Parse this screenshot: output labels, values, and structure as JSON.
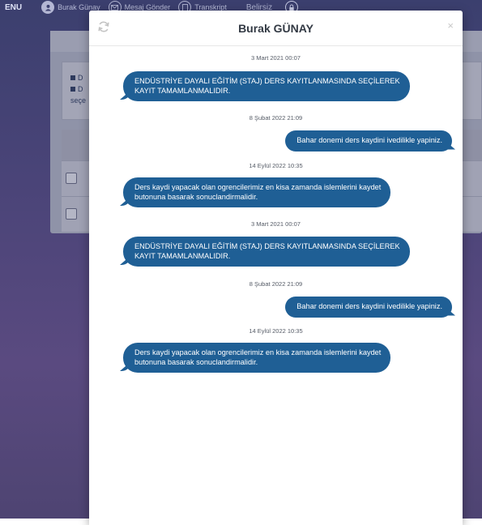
{
  "topbar": {
    "menu_label": "ENU",
    "items": [
      {
        "label": "Burak Günay",
        "icon": "user-icon"
      },
      {
        "label": "Mesaj Gönder",
        "icon": "envelope-icon"
      },
      {
        "label": "Transkript",
        "icon": "document-icon"
      }
    ],
    "status_label": "Belirsiz",
    "lock_icon": "lock-icon"
  },
  "background": {
    "card_lines": [
      "D",
      "D",
      "seçe"
    ]
  },
  "modal": {
    "title": "Burak GÜNAY",
    "refresh_icon": "refresh-icon",
    "close_glyph": "×"
  },
  "messages": [
    {
      "time": "3 Mart 2021 00:07",
      "side": "left",
      "lines": [
        "ENDÜSTRİYE DAYALI EĞİTİM (STAJ) DERS KAYITLANMASINDA SEÇİLEREK",
        "KAYIT TAMAMLANMALIDIR."
      ]
    },
    {
      "time": "8 Şubat 2022 21:09",
      "side": "right",
      "lines": [
        "Bahar donemi ders kaydini ivedilikle yapiniz."
      ]
    },
    {
      "time": "14 Eylül 2022 10:35",
      "side": "left",
      "lines": [
        "Ders kaydi yapacak olan ogrencilerimiz en kisa zamanda islemlerini kaydet",
        "butonuna basarak sonuclandirmalidir."
      ]
    },
    {
      "time": "3 Mart 2021 00:07",
      "side": "left",
      "lines": [
        "ENDÜSTRİYE DAYALI EĞİTİM (STAJ) DERS KAYITLANMASINDA SEÇİLEREK",
        "KAYIT TAMAMLANMALIDIR."
      ]
    },
    {
      "time": "8 Şubat 2022 21:09",
      "side": "right",
      "lines": [
        "Bahar donemi ders kaydini ivedilikle yapiniz."
      ]
    },
    {
      "time": "14 Eylül 2022 10:35",
      "side": "left",
      "lines": [
        "Ders kaydi yapacak olan ogrencilerimiz en kisa zamanda islemlerini kaydet",
        "butonuna basarak sonuclandirmalidir."
      ]
    }
  ],
  "colors": {
    "bubble": "#1f5f95",
    "bubble_text": "#ffffff",
    "backdrop": "#4a4478"
  }
}
